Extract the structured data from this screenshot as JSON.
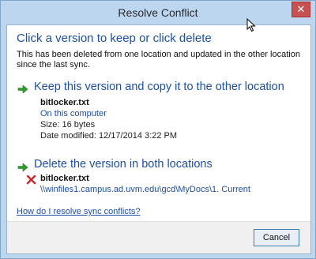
{
  "window": {
    "title": "Resolve Conflict",
    "close_glyph": "✕"
  },
  "header": {
    "heading": "Click a version to keep or click delete",
    "description": "This has been deleted from one location and updated in the other location since the last sync."
  },
  "keep_option": {
    "title": "Keep this version and copy it to the other location",
    "icon": "green-arrow-icon",
    "file_name": "bitlocker.txt",
    "location": "On this computer",
    "size": "Size: 16 bytes",
    "modified": "Date modified: 12/17/2014 3:22 PM"
  },
  "delete_option": {
    "title": "Delete the version in both locations",
    "icon": "red-x-icon",
    "file_name": "bitlocker.txt",
    "path": "\\\\winfiles1.campus.ad.uvm.edu\\gcd\\MyDocs\\1. Current"
  },
  "help_link": "How do I resolve sync conflicts?",
  "footer": {
    "cancel_label": "Cancel"
  },
  "colors": {
    "accent": "#1e4fa3",
    "arrow_green": "#2f9e2f",
    "delete_red": "#c62828",
    "titlebar": "#bcd6ef"
  }
}
